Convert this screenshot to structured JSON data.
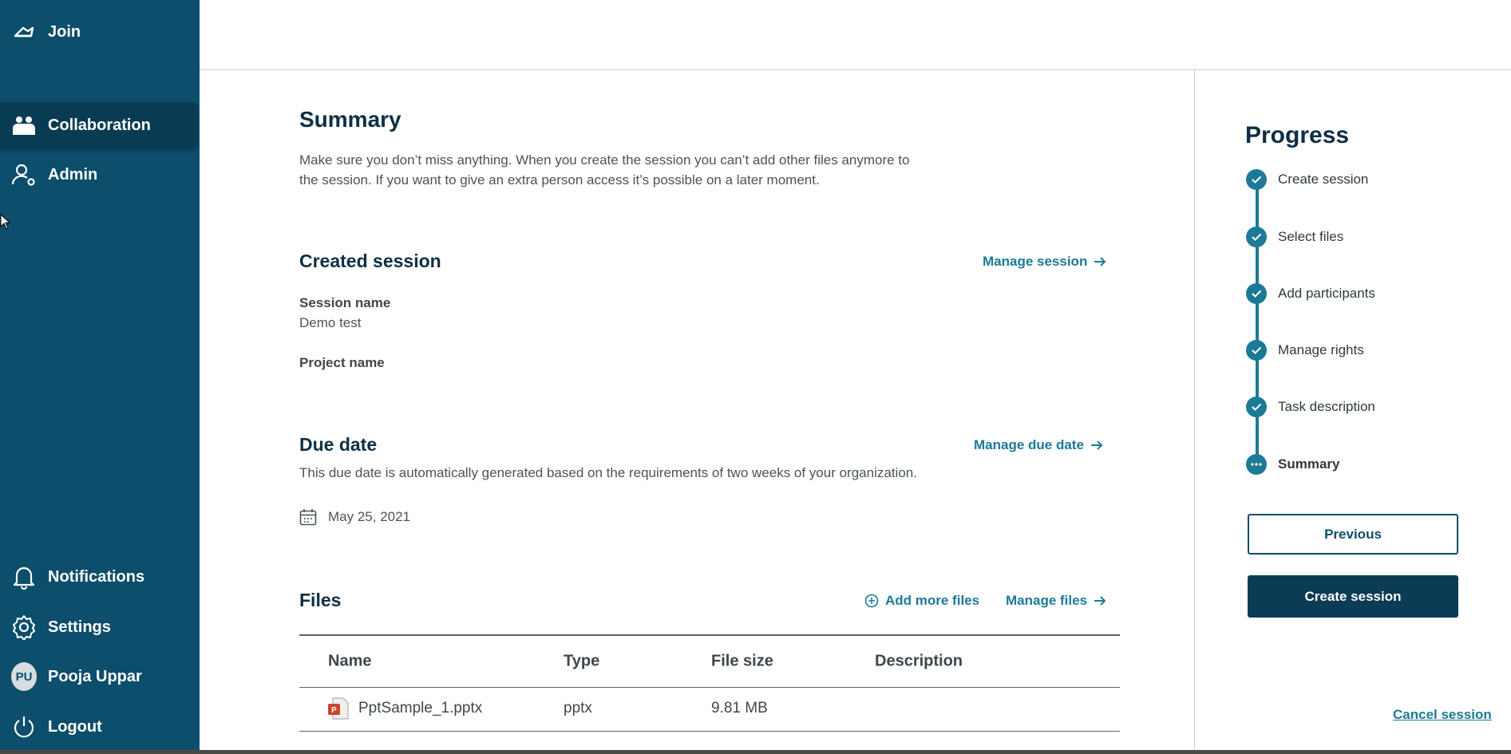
{
  "sidebar": {
    "join": "Join",
    "collaboration": "Collaboration",
    "admin": "Admin",
    "notifications": "Notifications",
    "settings": "Settings",
    "user_initials": "PU",
    "user_name": "Pooja Uppar",
    "logout": "Logout"
  },
  "summary": {
    "title": "Summary",
    "description_line1": "Make sure you don’t miss anything. When you create the session you can’t add other files anymore to",
    "description_line2": "the session. If you want to give an extra person access it’s possible on a later moment."
  },
  "created_session": {
    "title": "Created session",
    "manage_link": "Manage session",
    "session_name_label": "Session name",
    "session_name_value": "Demo test",
    "project_name_label": "Project name",
    "project_name_value": ""
  },
  "due_date": {
    "title": "Due date",
    "manage_link": "Manage due date",
    "description": "This due date is automatically generated based on the requirements of two weeks of your organization.",
    "date": "May 25, 2021"
  },
  "files": {
    "title": "Files",
    "add_more_link": "Add more files",
    "manage_link": "Manage files",
    "columns": [
      "Name",
      "Type",
      "File size",
      "Description"
    ],
    "rows": [
      {
        "name": "PptSample_1.pptx",
        "type": "pptx",
        "size": "9.81 MB",
        "description": ""
      }
    ]
  },
  "progress": {
    "title": "Progress",
    "steps": [
      "Create session",
      "Select files",
      "Add participants",
      "Manage rights",
      "Task description",
      "Summary"
    ],
    "current_step": "Summary"
  },
  "actions": {
    "previous": "Previous",
    "create_session": "Create session",
    "cancel": "Cancel session"
  },
  "colors": {
    "sidebar": "#0c4e6b",
    "accent": "#1c7a96",
    "primary_button": "#0c3c55"
  }
}
